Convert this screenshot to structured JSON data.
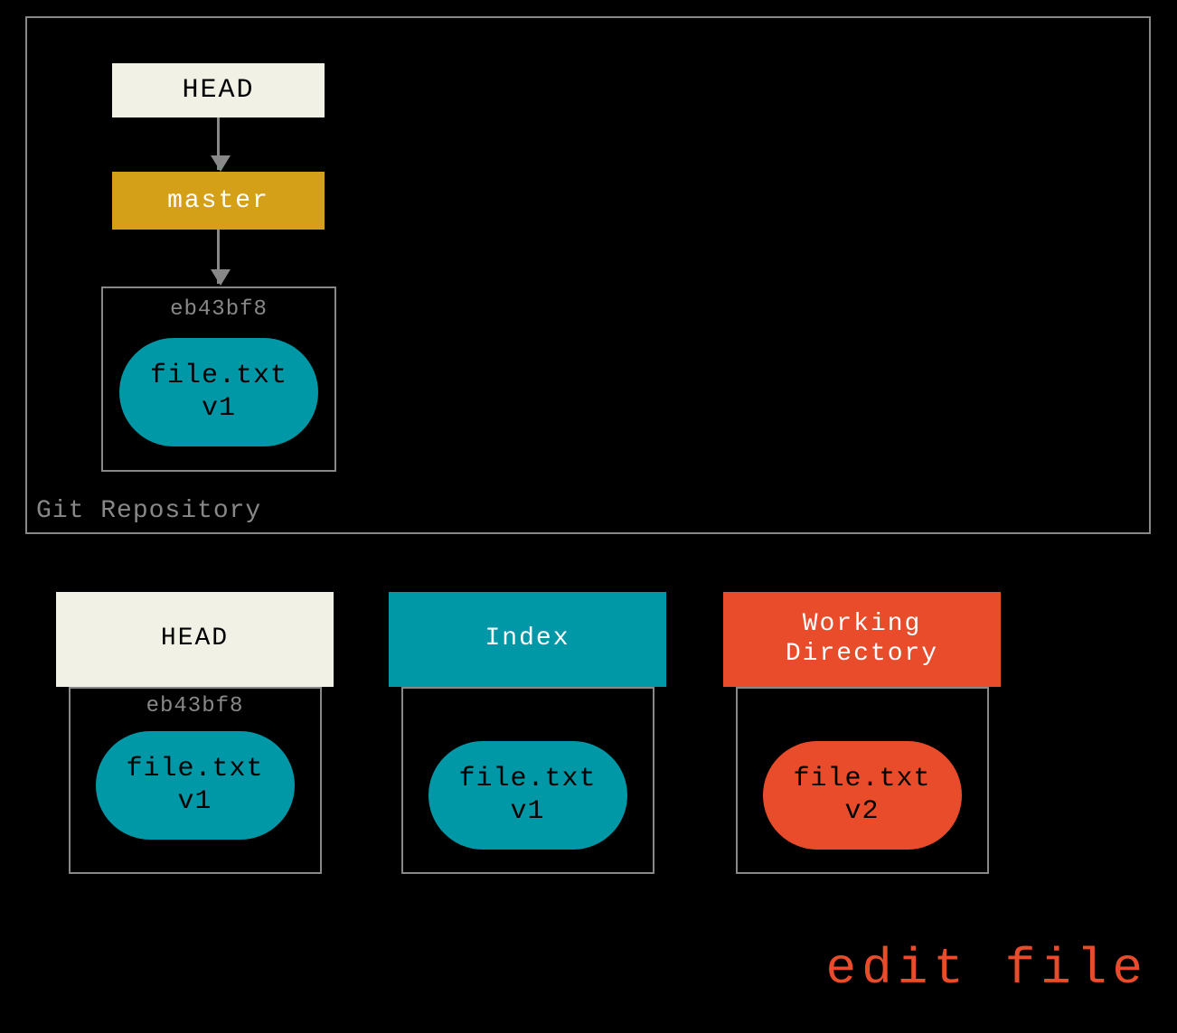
{
  "repo": {
    "label": "Git Repository",
    "head": "HEAD",
    "branch": "master",
    "commit": {
      "hash": "eb43bf8",
      "file": "file.txt",
      "version": "v1"
    }
  },
  "columns": {
    "head": {
      "title": "HEAD",
      "hash": "eb43bf8",
      "file": "file.txt",
      "version": "v1"
    },
    "index": {
      "title": "Index",
      "file": "file.txt",
      "version": "v1"
    },
    "working": {
      "title_line1": "Working",
      "title_line2": "Directory",
      "file": "file.txt",
      "version": "v2"
    }
  },
  "caption": "edit file",
  "colors": {
    "cream": "#f1f1e6",
    "mustard": "#d4a017",
    "teal": "#0097a7",
    "orange": "#e84c2b",
    "border": "#888888"
  }
}
